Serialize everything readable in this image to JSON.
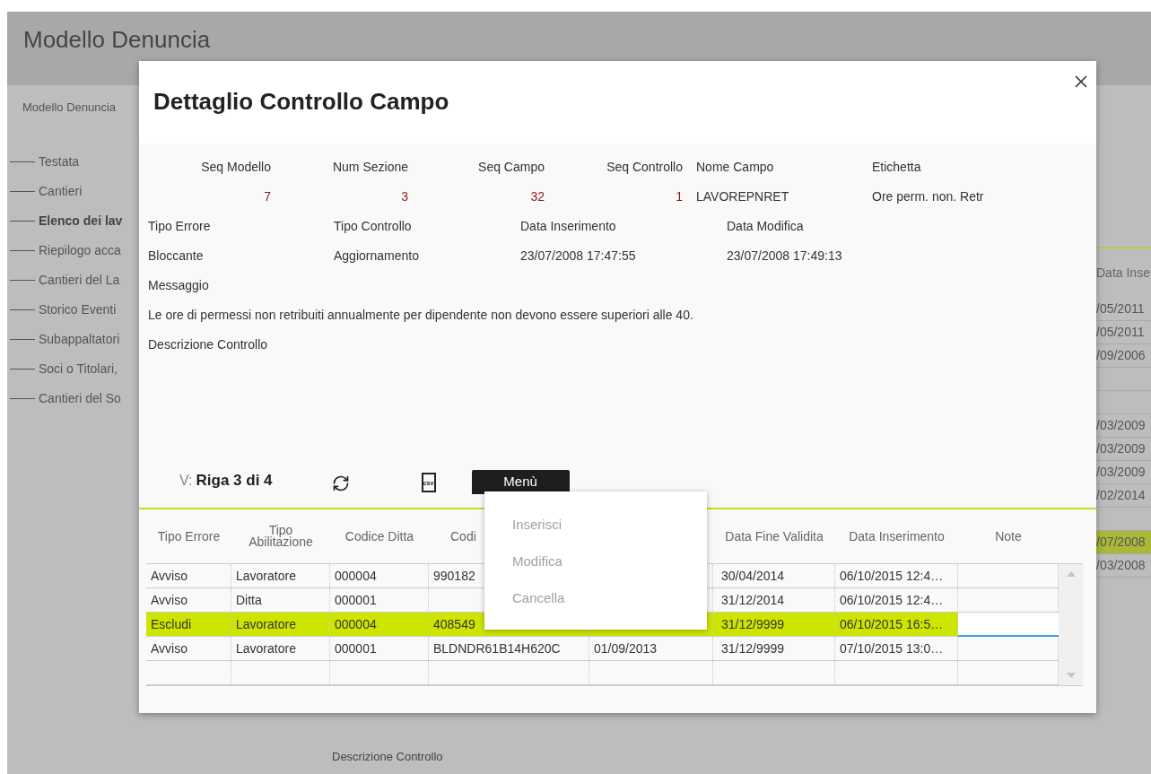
{
  "page": {
    "title": "Modello Denuncia",
    "breadcrumb": "Modello Denuncia",
    "bottom_label": "Descrizione Controllo"
  },
  "sidebar": {
    "items": [
      {
        "label": "Testata",
        "selected": false
      },
      {
        "label": "Cantieri",
        "selected": false
      },
      {
        "label": "Elenco dei lav",
        "selected": true
      },
      {
        "label": "Riepilogo acca",
        "selected": false
      },
      {
        "label": "Cantieri del La",
        "selected": false
      },
      {
        "label": "Storico Eventi",
        "selected": false
      },
      {
        "label": "Subappaltatori",
        "selected": false
      },
      {
        "label": "Soci o Titolari,",
        "selected": false
      },
      {
        "label": "Cantieri del So",
        "selected": false
      }
    ]
  },
  "background_table": {
    "column": "Data Inse",
    "rows": [
      {
        "value": "/05/2011",
        "selected": false
      },
      {
        "value": "/05/2011",
        "selected": false
      },
      {
        "value": "/09/2006",
        "selected": false
      },
      {
        "selected": false
      },
      {
        "selected": false
      },
      {
        "value": "/03/2009",
        "selected": false
      },
      {
        "value": "/03/2009",
        "selected": false
      },
      {
        "value": "/03/2009",
        "selected": false
      },
      {
        "value": "/02/2014",
        "selected": false
      },
      {
        "selected": false
      },
      {
        "value": "/07/2008",
        "selected": true
      },
      {
        "value": "/03/2008",
        "selected": false
      }
    ]
  },
  "dialog": {
    "title": "Dettaglio Controllo Campo",
    "top_fields": [
      {
        "label": "Seq Modello",
        "value": "7",
        "kind": "number"
      },
      {
        "label": "Num Sezione",
        "value": "3",
        "kind": "number"
      },
      {
        "label": "Seq Campo",
        "value": "32",
        "kind": "number"
      },
      {
        "label": "Seq Controllo",
        "value": "1",
        "kind": "number"
      },
      {
        "label": "Nome Campo",
        "value": "LAVOREPNRET",
        "kind": "text"
      },
      {
        "label": "Etichetta",
        "value": "Ore perm. non. Retr",
        "kind": "text"
      }
    ],
    "second_fields": [
      {
        "label": "Tipo Errore",
        "value": "Bloccante"
      },
      {
        "label": "Tipo Controllo",
        "value": "Aggiornamento"
      },
      {
        "label": "Data Inserimento",
        "value": "23/07/2008 17:47:55"
      },
      {
        "label": "Data Modifica",
        "value": "23/07/2008 17:49:13"
      }
    ],
    "message_label": "Messaggio",
    "message": "Le ore di permessi non retribuiti annualmente per dipendente non devono essere superiori alle 40.",
    "description_label": "Descrizione Controllo",
    "toolbar": {
      "view_prefix": "V:",
      "position": "Riga 3 di 4",
      "csv_label": "csv",
      "menu_button": "Menù"
    },
    "menu": {
      "open": true,
      "items": [
        {
          "label": "Inserisci",
          "disabled": true
        },
        {
          "label": "Modifica",
          "disabled": true
        },
        {
          "label": "Cancella",
          "disabled": true
        }
      ]
    },
    "table": {
      "columns": [
        {
          "label": "Tipo Errore"
        },
        {
          "label": "Tipo Abilitazione"
        },
        {
          "label": "Codice Ditta"
        },
        {
          "label": "Codi"
        },
        {},
        {
          "label": "Data Fine Validita"
        },
        {
          "label": "Data Inserimento"
        },
        {
          "label": "Note"
        }
      ],
      "rows": [
        {
          "cells": [
            {
              "text": "Avviso"
            },
            {
              "text": "Lavoratore"
            },
            {
              "text": "000004"
            },
            {
              "text": "990182"
            },
            {},
            {
              "text": "30/04/2014"
            },
            {
              "text": "06/10/2015 12:4…"
            },
            {}
          ],
          "selected": false,
          "note_editing": false
        },
        {
          "cells": [
            {
              "text": "Avviso"
            },
            {
              "text": "Ditta"
            },
            {
              "text": "000001"
            },
            {},
            {},
            {
              "text": "31/12/2014"
            },
            {
              "text": "06/10/2015 12:4…"
            },
            {}
          ],
          "selected": false,
          "note_editing": false
        },
        {
          "cells": [
            {
              "text": "Escludi"
            },
            {
              "text": "Lavoratore"
            },
            {
              "text": "000004"
            },
            {
              "text": "408549"
            },
            {},
            {
              "text": "31/12/9999"
            },
            {
              "text": "06/10/2015 16:5…"
            },
            {}
          ],
          "selected": true,
          "note_editing": true
        },
        {
          "cells": [
            {
              "text": "Avviso"
            },
            {
              "text": "Lavoratore"
            },
            {
              "text": "000001"
            },
            {
              "text": "BLDNDR61B14H620C"
            },
            {
              "text": "01/09/2013"
            },
            {
              "text": "31/12/9999"
            },
            {
              "text": "07/10/2015 13:0…"
            },
            {}
          ],
          "selected": false,
          "note_editing": false
        },
        {
          "cells": [
            {},
            {},
            {},
            {},
            {},
            {},
            {},
            {}
          ],
          "selected": false,
          "note_editing": false
        }
      ]
    }
  }
}
